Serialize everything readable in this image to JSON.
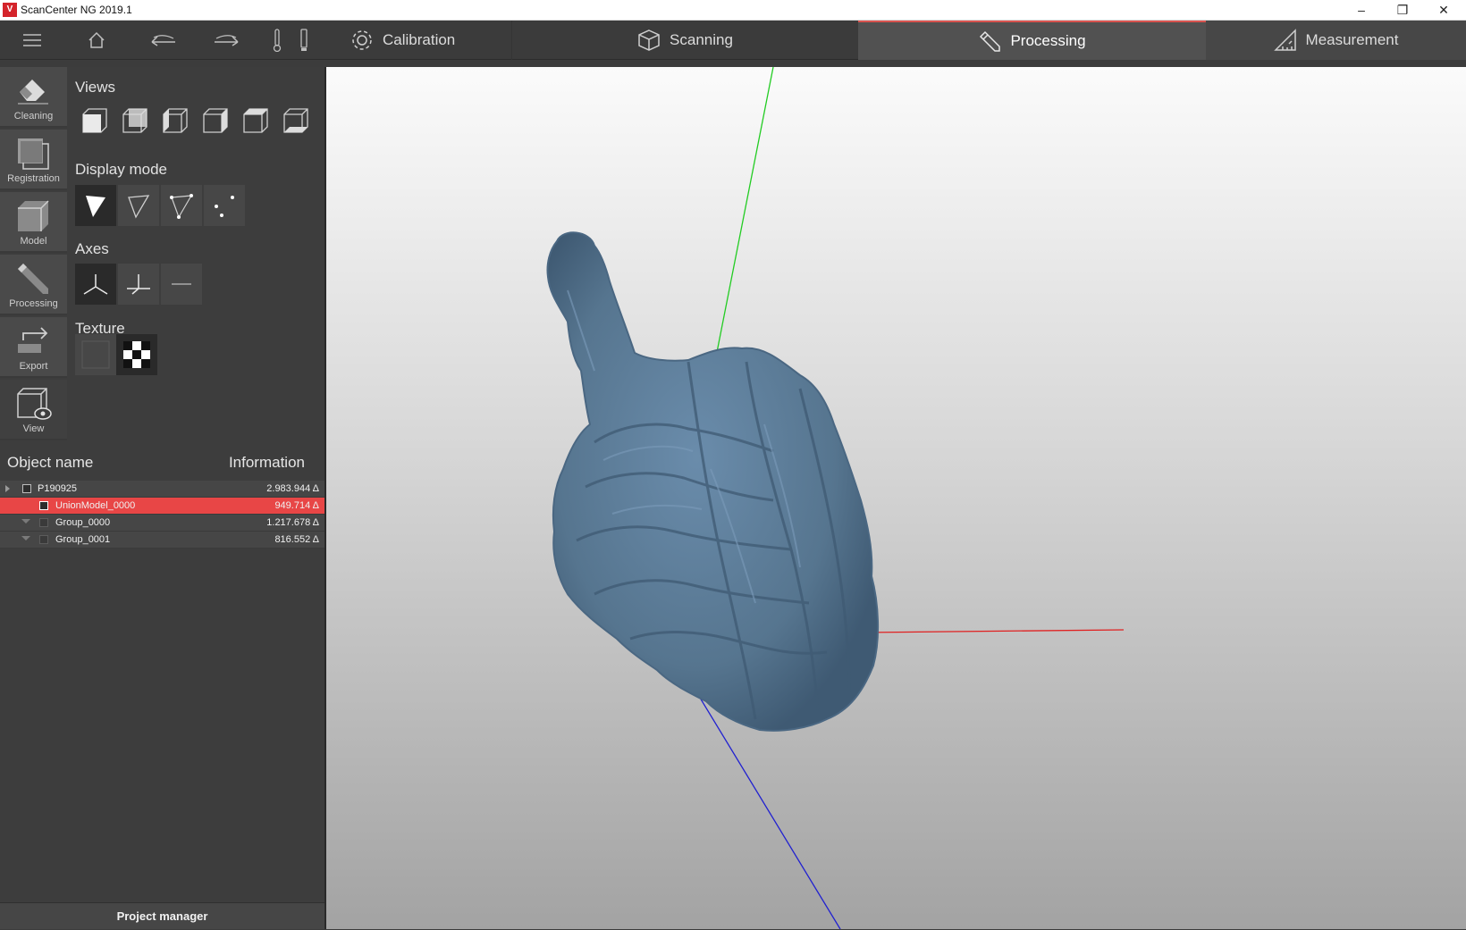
{
  "window": {
    "title": "ScanCenter NG 2019.1",
    "logo_text": "V",
    "controls": [
      "–",
      "❐",
      "✕"
    ]
  },
  "toolbar": {
    "icons": [
      "menu-icon",
      "home-icon",
      "undo-icon",
      "redo-icon",
      "thermometer-icon",
      "indicator-icon"
    ],
    "tabs": [
      {
        "label": "Calibration",
        "icon": "gear-icon"
      },
      {
        "label": "Scanning",
        "icon": "cube-icon"
      },
      {
        "label": "Processing",
        "icon": "pencil-icon",
        "active": true
      },
      {
        "label": "Measurement",
        "icon": "triangle-ruler-icon"
      }
    ],
    "accent_color": "#d9534f"
  },
  "rail": {
    "items": [
      {
        "label": "Cleaning",
        "icon": "eraser-icon"
      },
      {
        "label": "Registration",
        "icon": "registration-icon"
      },
      {
        "label": "Model",
        "icon": "model-icon"
      },
      {
        "label": "Processing",
        "icon": "pencil-icon"
      },
      {
        "label": "Export",
        "icon": "export-icon"
      },
      {
        "label": "View",
        "icon": "view-icon"
      }
    ]
  },
  "options": {
    "views_title": "Views",
    "display_mode_title": "Display mode",
    "axes_title": "Axes",
    "texture_title": "Texture"
  },
  "objects": {
    "header_name": "Object name",
    "header_info": "Information",
    "rows": [
      {
        "name": "P190925",
        "info": "2.983.944 Δ",
        "level": 0,
        "selected": false
      },
      {
        "name": "UnionModel_0000",
        "info": "949.714 Δ",
        "level": 1,
        "selected": true
      },
      {
        "name": "Group_0000",
        "info": "1.217.678 Δ",
        "level": 1,
        "selected": false
      },
      {
        "name": "Group_0001",
        "info": "816.552 Δ",
        "level": 1,
        "selected": false
      }
    ],
    "selection_color": "#e84646",
    "footer": "Project manager"
  },
  "viewport": {
    "model_color": "#5b7a98",
    "axis_x_color": "#e02020",
    "axis_y_color": "#22cc22",
    "axis_z_color": "#2020d0"
  }
}
